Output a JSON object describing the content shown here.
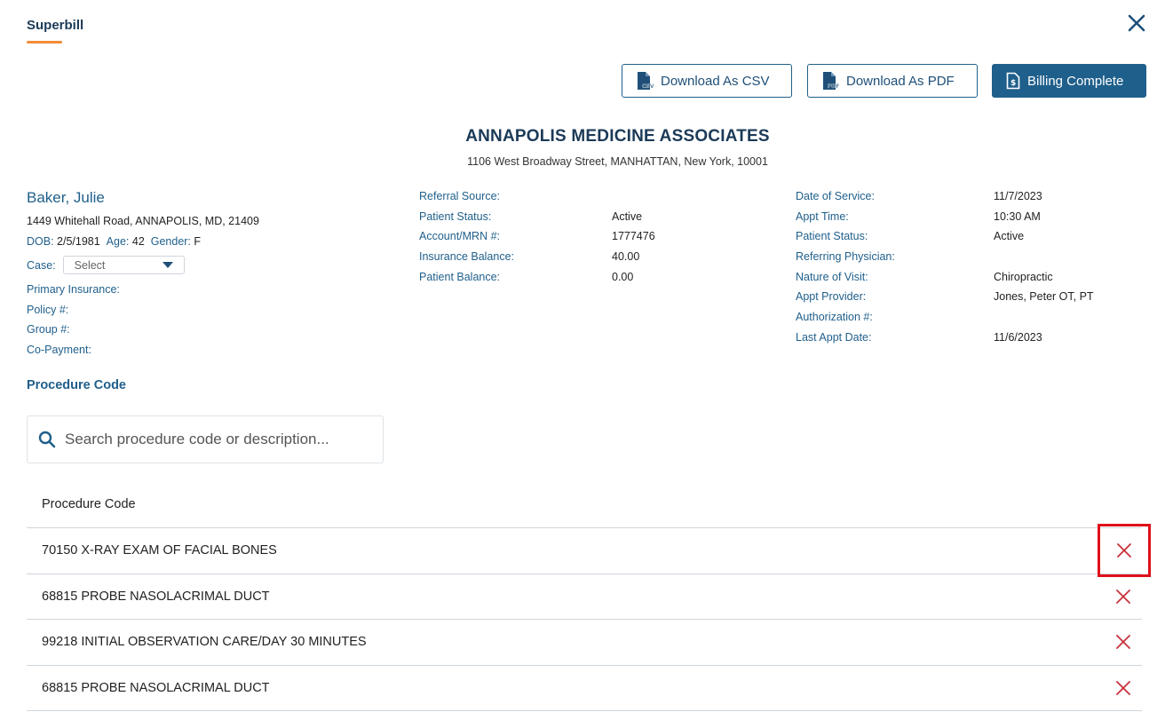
{
  "header": {
    "tab_title": "Superbill"
  },
  "actions": {
    "csv": "Download As CSV",
    "pdf": "Download As PDF",
    "complete": "Billing Complete"
  },
  "org": {
    "name": "ANNAPOLIS MEDICINE ASSOCIATES",
    "address": "1106 West Broadway Street, MANHATTAN, New York, 10001"
  },
  "patient": {
    "name": "Baker, Julie",
    "address": "1449 Whitehall Road, ANNAPOLIS, MD, 21409",
    "dob_label": "DOB:",
    "dob": "2/5/1981",
    "age_label": "Age:",
    "age": "42",
    "gender_label": "Gender:",
    "gender": "F",
    "case_label": "Case:",
    "case_value": "Select",
    "insurance": [
      "Primary Insurance:",
      "Policy #:",
      "Group #:",
      "Co-Payment:"
    ]
  },
  "account": [
    {
      "label": "Referral Source:",
      "value": ""
    },
    {
      "label": "Patient Status:",
      "value": "Active"
    },
    {
      "label": "Account/MRN #:",
      "value": "1777476"
    },
    {
      "label": "Insurance Balance:",
      "value": "40.00"
    },
    {
      "label": "Patient Balance:",
      "value": "0.00"
    }
  ],
  "visit": [
    {
      "label": "Date of Service:",
      "value": "11/7/2023"
    },
    {
      "label": "Appt Time:",
      "value": "10:30 AM"
    },
    {
      "label": "Patient Status:",
      "value": "Active"
    },
    {
      "label": "Referring Physician:",
      "value": ""
    },
    {
      "label": "Nature of Visit:",
      "value": "Chiropractic"
    },
    {
      "label": "Appt Provider:",
      "value": "Jones, Peter OT, PT"
    },
    {
      "label": "Authorization #:",
      "value": ""
    },
    {
      "label": "Last Appt Date:",
      "value": "11/6/2023"
    }
  ],
  "procedures": {
    "section_title": "Procedure Code",
    "search_placeholder": "Search procedure code or description...",
    "column_header": "Procedure Code",
    "rows": [
      "70150 X-RAY EXAM OF FACIAL BONES",
      "68815 PROBE NASOLACRIMAL DUCT",
      "99218 INITIAL OBSERVATION CARE/DAY 30 MINUTES",
      "68815 PROBE NASOLACRIMAL DUCT"
    ]
  },
  "colors": {
    "accent": "#1f5f8b",
    "tab_underline": "#f28c38",
    "delete": "#c8323a",
    "highlight": "#e0101a"
  }
}
